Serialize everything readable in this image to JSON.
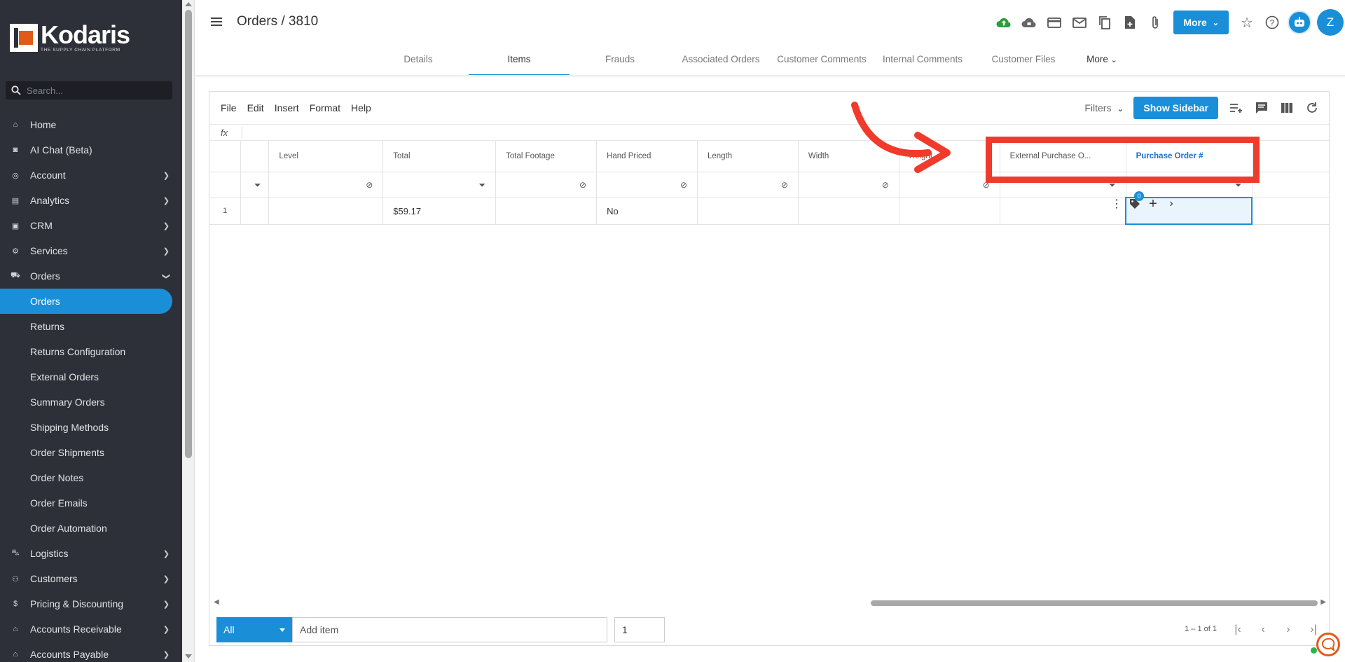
{
  "brand": {
    "name": "Kodaris",
    "tagline": "THE SUPPLY CHAIN PLATFORM"
  },
  "search": {
    "placeholder": "Search..."
  },
  "nav": {
    "home": "Home",
    "ai_chat": "AI Chat (Beta)",
    "account": "Account",
    "analytics": "Analytics",
    "crm": "CRM",
    "services": "Services",
    "orders": "Orders",
    "orders_sub": [
      "Orders",
      "Returns",
      "Returns Configuration",
      "External Orders",
      "Summary Orders",
      "Shipping Methods",
      "Order Shipments",
      "Order Notes",
      "Order Emails",
      "Order Automation"
    ],
    "logistics": "Logistics",
    "customers": "Customers",
    "pricing": "Pricing & Discounting",
    "ar": "Accounts Receivable",
    "ap": "Accounts Payable"
  },
  "header": {
    "title": "Orders / 3810",
    "more_label": "More",
    "avatar_letter": "Z"
  },
  "tabs": [
    "Details",
    "Items",
    "Frauds",
    "Associated Orders",
    "Customer Comments",
    "Internal Comments",
    "Customer Files",
    "More"
  ],
  "toolbar": {
    "menus": [
      "File",
      "Edit",
      "Insert",
      "Format",
      "Help"
    ],
    "filters_label": "Filters",
    "show_sidebar_label": "Show Sidebar"
  },
  "formula_bar": {
    "label": "fx"
  },
  "grid": {
    "columns": [
      "Level",
      "Total",
      "Total Footage",
      "Hand Priced",
      "Length",
      "Width",
      "Height",
      "External Purchase O...",
      "Purchase Order #"
    ],
    "rows": [
      {
        "num": "1",
        "level": "",
        "total": "$59.17",
        "total_footage": "",
        "hand_priced": "No",
        "length": "",
        "width": "",
        "height": "",
        "external_po": "",
        "po": ""
      }
    ],
    "tags_count": "0"
  },
  "footer": {
    "select_label": "All",
    "add_item_placeholder": "Add item",
    "quantity": "1",
    "pager_text": "1 – 1 of 1"
  },
  "colors": {
    "accent": "#1a8fd8",
    "sidebar_bg": "#2d3038",
    "annotation": "#f03a2c",
    "upload_green": "#2a9d3a"
  }
}
